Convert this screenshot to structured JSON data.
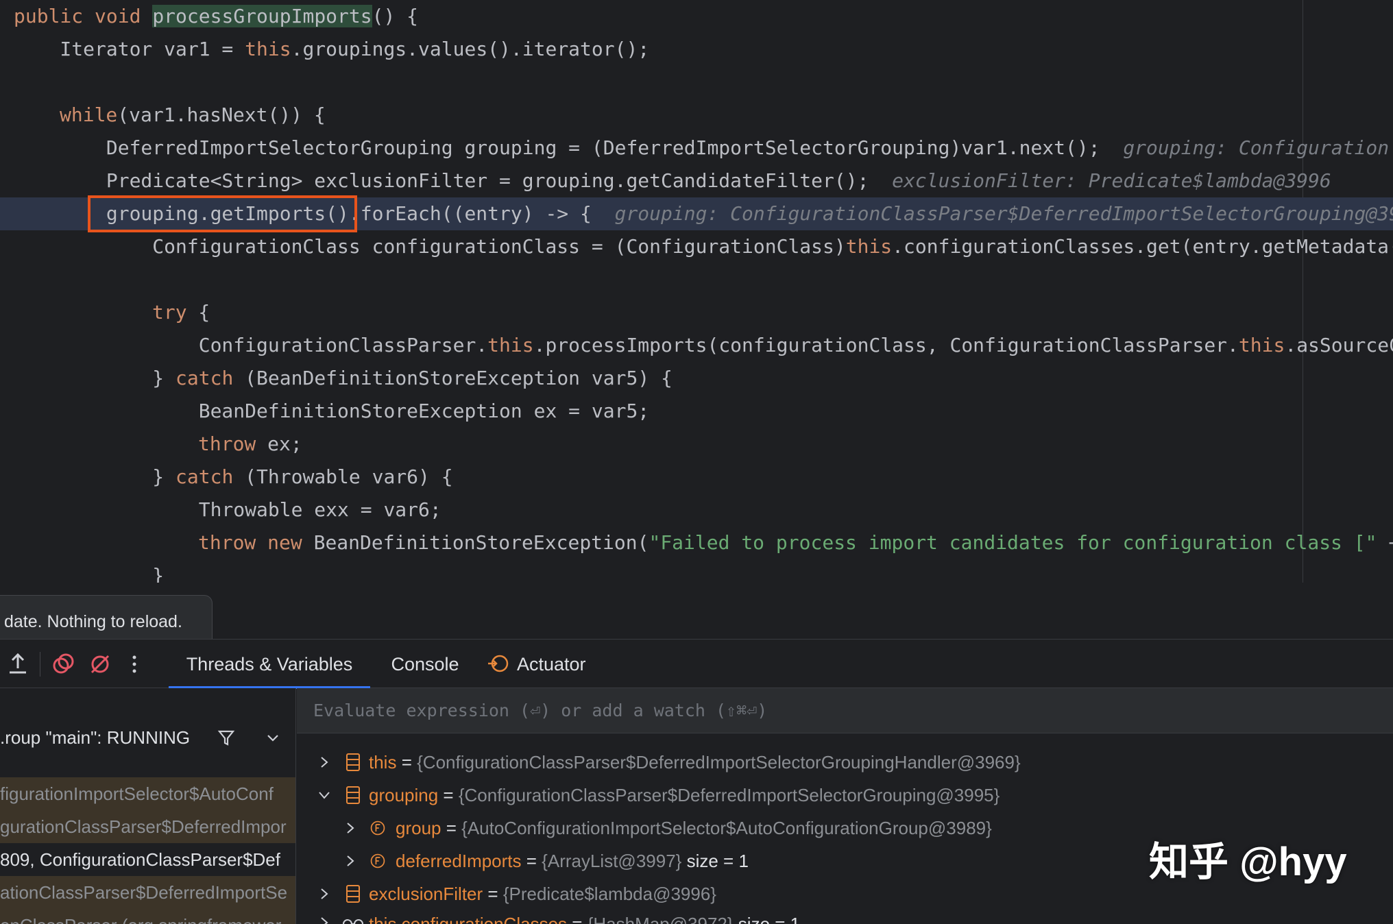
{
  "editor": {
    "line1": {
      "kw1": "public",
      "kw2": "void",
      "method": "processGroupImports",
      "rest": "() {"
    },
    "line2": {
      "pre": "    Iterator var1 = ",
      "kw": "this",
      "post": ".groupings.values().iterator();"
    },
    "line4": {
      "kw": "while",
      "post": "(var1.hasNext()) {"
    },
    "line5": {
      "code": "        DeferredImportSelectorGrouping grouping = (DeferredImportSelectorGrouping)var1.next();",
      "hint": "grouping: Configuration"
    },
    "line6": {
      "code": "        Predicate<String> exclusionFilter = grouping.getCandidateFilter();",
      "hint": "exclusionFilter: Predicate$lambda@3996"
    },
    "line7": {
      "code": "        grouping.getImports().forEach((entry) -> {",
      "hint": "grouping: ConfigurationClassParser$DeferredImportSelectorGrouping@39"
    },
    "line8": {
      "pre": "            ConfigurationClass configurationClass = (ConfigurationClass)",
      "kw": "this",
      "post": ".configurationClasses.get(entry.getMetadata("
    },
    "line10": {
      "kw": "try",
      "post": " {"
    },
    "line11": {
      "pre": "                ConfigurationClassParser.",
      "kw": "this",
      "mid": ".processImports(configurationClass, ConfigurationClassParser.",
      "kw2": "this",
      "post": ".asSourceC"
    },
    "line12": {
      "pre": "            } ",
      "kw": "catch",
      "post": " (BeanDefinitionStoreException var5) {"
    },
    "line13": {
      "code": "                BeanDefinitionStoreException ex = var5;"
    },
    "line14": {
      "kw": "throw",
      "post": " ex;"
    },
    "line15": {
      "pre": "            } ",
      "kw": "catch",
      "post": " (Throwable var6) {"
    },
    "line16": {
      "code": "                Throwable exx = var6;"
    },
    "line17": {
      "kw1": "throw",
      "kw2": "new",
      "mid": " BeanDefinitionStoreException(",
      "str": "\"Failed to process import candidates for configuration class [\"",
      "post": " +"
    },
    "line18": {
      "code": "            }"
    }
  },
  "notification": {
    "text": "date. Nothing to reload."
  },
  "toolbar": {
    "tabs": [
      "Threads & Variables",
      "Console",
      "Actuator"
    ]
  },
  "threads": {
    "thread_label": ".roup \"main\": RUNNING",
    "frames": [
      "figurationImportSelector$AutoConf",
      "gurationClassParser$DeferredImpor",
      "809, ConfigurationClassParser$Def",
      "ationClassParser$DeferredImportSe",
      "onClassParser (org.springframewor"
    ]
  },
  "variables": {
    "eval_placeholder": "Evaluate expression (⏎) or add a watch (⇧⌘⏎)",
    "items": [
      {
        "name": "this",
        "eq": " = ",
        "value": "{ConfigurationClassParser$DeferredImportSelectorGroupingHandler@3969}",
        "size": ""
      },
      {
        "name": "grouping",
        "eq": " = ",
        "value": "{ConfigurationClassParser$DeferredImportSelectorGrouping@3995}",
        "size": ""
      },
      {
        "name": "group",
        "eq": " = ",
        "value": "{AutoConfigurationImportSelector$AutoConfigurationGroup@3989}",
        "size": ""
      },
      {
        "name": "deferredImports",
        "eq": " = ",
        "value": "{ArrayList@3997}",
        "size": " size = 1"
      },
      {
        "name": "exclusionFilter",
        "eq": " = ",
        "value": "{Predicate$lambda@3996}",
        "size": ""
      },
      {
        "name": "this.configurationClasses",
        "eq": " = ",
        "value": "{HashMap@3972}",
        "size": " size = 1"
      }
    ]
  },
  "watermark": "知乎 @hyy"
}
